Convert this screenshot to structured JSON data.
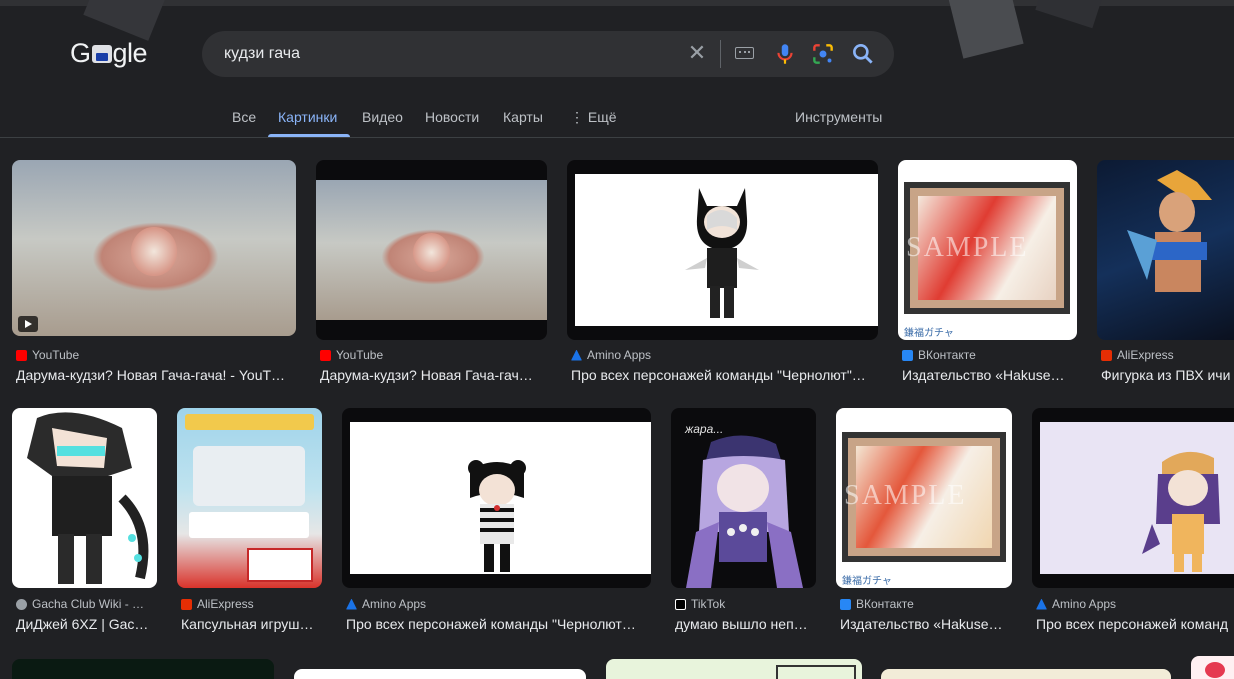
{
  "logo_text": "Google",
  "search": {
    "query": "кудзи гача"
  },
  "tabs": [
    {
      "label": "Все"
    },
    {
      "label": "Картинки"
    },
    {
      "label": "Видео"
    },
    {
      "label": "Новости"
    },
    {
      "label": "Карты"
    },
    {
      "label": "Ещё"
    }
  ],
  "tools_label": "Инструменты",
  "row1": [
    {
      "source": "YouTube",
      "title": "Дарума-кудзи? Новая Гача-гача! - YouT…",
      "favicon": "youtube-icon"
    },
    {
      "source": "YouTube",
      "title": "Дарума-кудзи? Новая Гача-гач…",
      "favicon": "youtube-icon"
    },
    {
      "source": "Amino Apps",
      "title": "Про всех персонажей команды \"Чернолют\"…",
      "favicon": "amino-icon"
    },
    {
      "source": "ВКонтакте",
      "title": "Издательство «Hakuse…",
      "favicon": "vk-icon"
    },
    {
      "source": "AliExpress",
      "title": "Фигурка из ПВХ ичи",
      "favicon": "aliexpress-icon"
    }
  ],
  "row2": [
    {
      "source": "Gacha Club Wiki - …",
      "title": "ДиДжей 6XZ | Gac…",
      "favicon": "wiki-icon"
    },
    {
      "source": "AliExpress",
      "title": "Капсульная игруш…",
      "favicon": "aliexpress-icon"
    },
    {
      "source": "Amino Apps",
      "title": "Про всех персонажей команды \"Чернолют…",
      "favicon": "amino-icon"
    },
    {
      "source": "TikTok",
      "title": "думаю вышло неп…",
      "favicon": "tiktok-icon"
    },
    {
      "source": "ВКонтакте",
      "title": "Издательство «Hakuse…",
      "favicon": "vk-icon"
    },
    {
      "source": "Amino Apps",
      "title": "Про всех персонажей команд",
      "favicon": "amino-icon"
    }
  ],
  "image_text": {
    "sample": "SAMPLE",
    "brand": "鎌福ガチャ",
    "tiktok_caption": "жара..."
  },
  "colors": {
    "background": "#202124",
    "accent": "#8ab4f8",
    "search_bg": "#303134"
  }
}
